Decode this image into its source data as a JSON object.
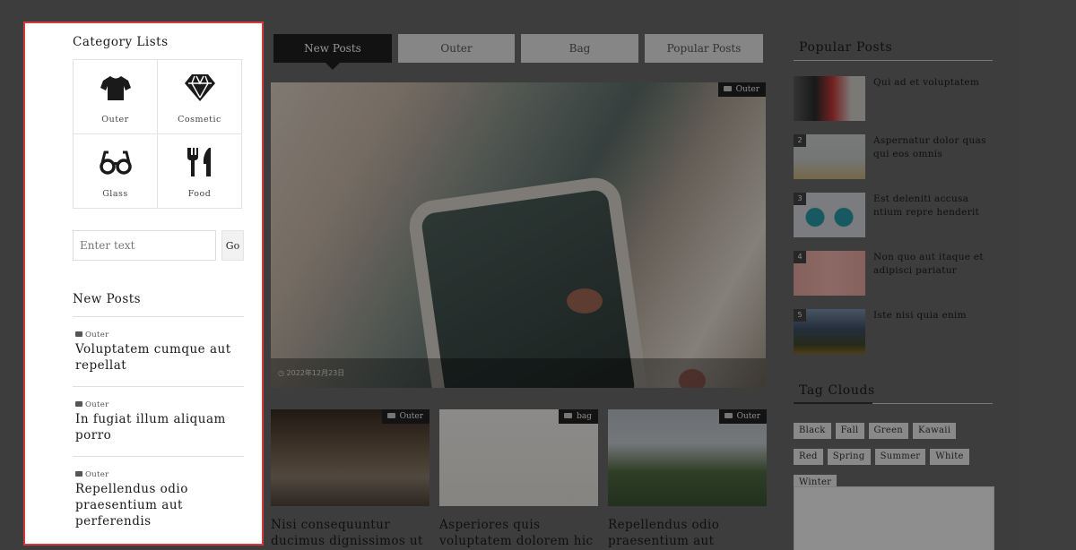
{
  "tabs": [
    "New Posts",
    "Outer",
    "Bag",
    "Popular Posts"
  ],
  "hero": {
    "category": "Outer",
    "date": "2022年12月23日"
  },
  "cards": [
    {
      "category": "Outer",
      "title": "Nisi consequuntur ducimus dignissimos ut"
    },
    {
      "category": "bag",
      "title": "Asperiores quis voluptatem dolorem hic sit"
    },
    {
      "category": "Outer",
      "title": "Repellendus odio praesentium aut"
    }
  ],
  "popular": {
    "title": "Popular Posts",
    "items": [
      {
        "rank": "",
        "title": "Qui ad et voluptatem"
      },
      {
        "rank": "2",
        "title": "Aspernatur dolor quas qui eos omnis"
      },
      {
        "rank": "3",
        "title": "Est deleniti accusa ntium repre henderit"
      },
      {
        "rank": "4",
        "title": "Non quo aut itaque et adipisci pariatur"
      },
      {
        "rank": "5",
        "title": "Iste nisi quia enim"
      }
    ]
  },
  "tag_clouds": {
    "title": "Tag Clouds",
    "tags": [
      "Black",
      "Fall",
      "Green",
      "Kawaii",
      "Red",
      "Spring",
      "Summer",
      "White",
      "Winter"
    ]
  },
  "panel": {
    "category_title": "Category Lists",
    "categories": [
      {
        "label": "Outer",
        "icon": "tshirt-icon"
      },
      {
        "label": "Cosmetic",
        "icon": "diamond-icon"
      },
      {
        "label": "Glass",
        "icon": "glasses-icon"
      },
      {
        "label": "Food",
        "icon": "fork-knife-icon"
      }
    ],
    "search": {
      "placeholder": "Enter text",
      "button": "Go"
    },
    "new_posts_title": "New Posts",
    "new_posts": [
      {
        "category": "Outer",
        "title": "Voluptatem cumque aut repellat"
      },
      {
        "category": "Outer",
        "title": "In fugiat illum aliquam porro"
      },
      {
        "category": "Outer",
        "title": "Repellendus odio praesentium aut perferendis"
      }
    ]
  },
  "colors": {
    "highlight_border": "#cf3b3b",
    "active_tab": "#1f1f1f",
    "overlay": "rgba(0,0,0,0.42)"
  }
}
